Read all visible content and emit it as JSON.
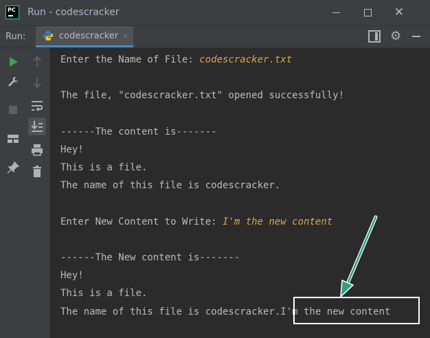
{
  "window": {
    "app_icon_text": "PC",
    "title": "Run - codescracker",
    "controls": {
      "minimize_icon": "minimize-icon",
      "maximize_icon": "maximize-icon",
      "close_icon": "close-icon"
    }
  },
  "run_panel": {
    "label": "Run:",
    "tab_label": "codescracker",
    "tab_icon": "python-icon",
    "tab_close": "×"
  },
  "console": {
    "lines": {
      "l1_prompt": "Enter the Name of File: ",
      "l1_input": "codescracker.txt",
      "l2": "The file, \"codescracker.txt\" opened successfully!",
      "l3": "------The content is-------",
      "l4": "Hey!",
      "l5": "This is a file.",
      "l6": "The name of this file is codescracker.",
      "l7_prompt": "Enter New Content to Write: ",
      "l7_input": "I'm the new content",
      "l8": "------The New content is-------",
      "l9": "Hey!",
      "l10": "This is a file.",
      "l11": "The name of this file is codescracker.I'm the new content"
    }
  },
  "colors": {
    "background": "#2b2b2b",
    "panel": "#3c3f41",
    "text": "#bbbbbb",
    "input_text": "#d7a74a",
    "annotation_arrow": "#2e9e80",
    "highlight_box": "#ffffff",
    "run_icon": "#499c54"
  }
}
